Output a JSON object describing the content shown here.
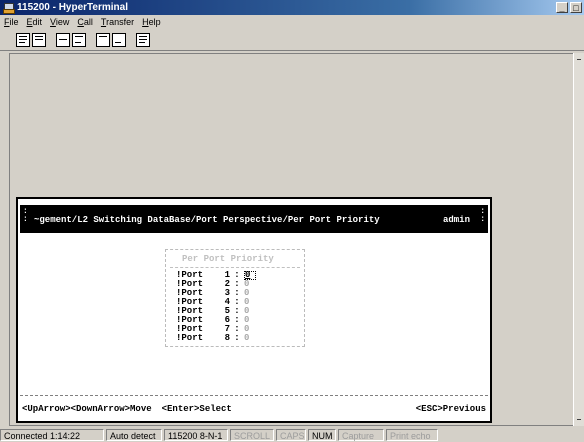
{
  "window": {
    "title": "115200 - HyperTerminal",
    "minimize": "_",
    "maximize": "□"
  },
  "menu": [
    {
      "acc": "F",
      "rest": "ile"
    },
    {
      "acc": "E",
      "rest": "dit"
    },
    {
      "acc": "V",
      "rest": "iew"
    },
    {
      "acc": "C",
      "rest": "all"
    },
    {
      "acc": "T",
      "rest": "ransfer"
    },
    {
      "acc": "H",
      "rest": "elp"
    }
  ],
  "toolbar": [
    "new-icon",
    "open-icon",
    "connect-icon",
    "disconnect-icon",
    "send-icon",
    "receive-icon",
    "properties-icon"
  ],
  "terminal": {
    "header_path": "~gement/L2 Switching DataBase/Port Perspective/Per Port Priority",
    "header_user": "admin",
    "panel_title": "Per Port Priority",
    "ports": [
      {
        "label": "!Port",
        "num": "1",
        "value": "0"
      },
      {
        "label": "!Port",
        "num": "2",
        "value": "0"
      },
      {
        "label": "!Port",
        "num": "3",
        "value": "0"
      },
      {
        "label": "!Port",
        "num": "4",
        "value": "0"
      },
      {
        "label": "!Port",
        "num": "5",
        "value": "0"
      },
      {
        "label": "!Port",
        "num": "6",
        "value": "0"
      },
      {
        "label": "!Port",
        "num": "7",
        "value": "0"
      },
      {
        "label": "!Port",
        "num": "8",
        "value": "0"
      }
    ],
    "footer_move": "<UpArrow><DownArrow>Move",
    "footer_select": "<Enter>Select",
    "footer_prev": "<ESC>Previous"
  },
  "status": {
    "connected": "Connected 1:14:22",
    "detect": "Auto detect",
    "settings": "115200 8-N-1",
    "scroll": "SCROLL",
    "caps": "CAPS",
    "num": "NUM",
    "capture": "Capture",
    "print_echo": "Print echo"
  },
  "colors": {
    "title_start": "#0a246a",
    "title_end": "#a6caf0",
    "terminal_bg": "#ffffff",
    "chrome": "#d4d0c8"
  }
}
